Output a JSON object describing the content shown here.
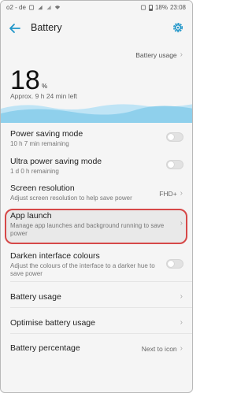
{
  "statusbar": {
    "carrier": "o2 - de",
    "battery": "18%",
    "time": "23:08"
  },
  "header": {
    "title": "Battery"
  },
  "battery_usage_link": "Battery usage",
  "level": {
    "value": "18",
    "unit": "%",
    "remaining": "Approx. 9 h 24 min left"
  },
  "settings": [
    {
      "title": "Power saving mode",
      "subtitle": "10 h 7 min remaining"
    },
    {
      "title": "Ultra power saving mode",
      "subtitle": "1 d 0 h remaining"
    },
    {
      "title": "Screen resolution",
      "subtitle": "Adjust screen resolution to help save power",
      "value": "FHD+"
    },
    {
      "title": "App launch",
      "subtitle": "Manage app launches and background running to save power"
    },
    {
      "title": "Darken interface colours",
      "subtitle": "Adjust the colours of the interface to a darker hue to save power"
    },
    {
      "title": "Battery usage"
    },
    {
      "title": "Optimise battery usage"
    },
    {
      "title": "Battery percentage",
      "value": "Next to icon"
    }
  ],
  "icons": [
    "back-arrow-icon",
    "gear-icon",
    "chevron-right-icon",
    "wifi-icon",
    "signal-icon",
    "battery-icon",
    "sim-icon"
  ],
  "colors": {
    "accent": "#2196c9",
    "wave": "#8fd0ec",
    "highlight_border": "#d64848"
  }
}
